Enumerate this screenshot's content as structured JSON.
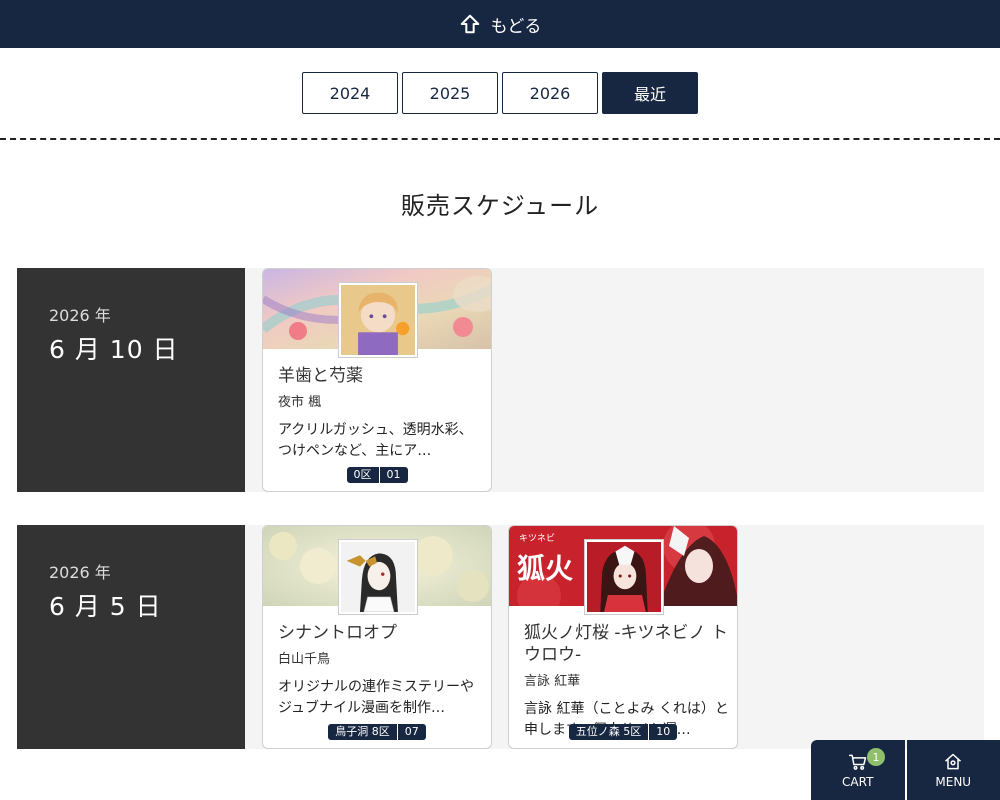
{
  "header": {
    "back_label": "もどる",
    "icon": "arrow-up-icon"
  },
  "years": {
    "items": [
      "2024",
      "2025",
      "2026",
      "最近"
    ],
    "active_index": 3
  },
  "page_title": "販売スケジュール",
  "days": [
    {
      "year": "2026 年",
      "month_day": "6 月 10 日",
      "cards": [
        {
          "title": "羊歯と芍薬",
          "author": "夜市 楓",
          "description": "アクリルガッシュ、透明水彩、つけペンなど、主にア…",
          "area": "0区",
          "booth": "01"
        }
      ]
    },
    {
      "year": "2026 年",
      "month_day": "6 月 5 日",
      "cards": [
        {
          "title": "シナントロオプ",
          "author": "白山千鳥",
          "description": "オリジナルの連作ミステリーやジュブナイル漫画を制作…",
          "area": "鳥子洞 8区",
          "booth": "07"
        },
        {
          "title": "狐火ノ灯桜 -キツネビノ トウロウ-",
          "author": "言詠 紅華",
          "description": "言詠 紅華（ことよみ くれは）と申します。個人サイト運…",
          "area": "五位ノ森 5区",
          "booth": "10",
          "banner_text": "狐火",
          "banner_kana": "キツネビ"
        }
      ]
    }
  ],
  "bottom_nav": {
    "cart_label": "CART",
    "cart_count": "1",
    "menu_label": "MENU"
  },
  "colors": {
    "navy": "#172742",
    "date_panel": "#333333",
    "badge": "#8fbf6a"
  }
}
